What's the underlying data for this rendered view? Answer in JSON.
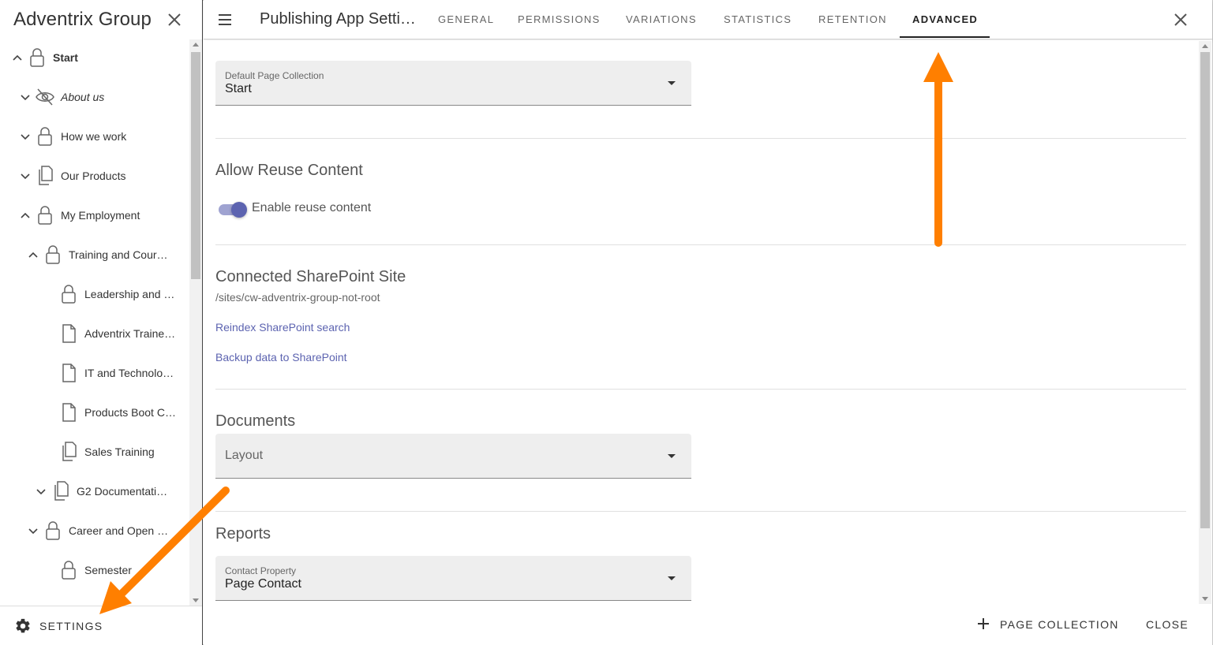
{
  "sidebar": {
    "title": "Adventrix Group",
    "items": [
      {
        "label": "Start",
        "chevron": "up",
        "icon": "lock-icon",
        "style": "bold"
      },
      {
        "label": "About us",
        "chevron": "down",
        "icon": "eye-off-icon",
        "style": "italic"
      },
      {
        "label": "How we work",
        "chevron": "down",
        "icon": "lock-icon",
        "style": ""
      },
      {
        "label": "Our Products",
        "chevron": "down",
        "icon": "pages-icon",
        "style": ""
      },
      {
        "label": "My Employment",
        "chevron": "up",
        "icon": "lock-icon",
        "style": ""
      },
      {
        "label": "Training and Cour…",
        "chevron": "up",
        "icon": "lock-icon",
        "style": ""
      },
      {
        "label": "Leadership and …",
        "chevron": "",
        "icon": "lock-icon",
        "style": ""
      },
      {
        "label": "Adventrix Traine…",
        "chevron": "",
        "icon": "page-icon",
        "style": ""
      },
      {
        "label": "IT and Technolo…",
        "chevron": "",
        "icon": "page-icon",
        "style": ""
      },
      {
        "label": "Products Boot C…",
        "chevron": "",
        "icon": "page-icon",
        "style": ""
      },
      {
        "label": "Sales Training",
        "chevron": "",
        "icon": "pages-icon",
        "style": ""
      },
      {
        "label": "G2 Documentati…",
        "chevron": "down",
        "icon": "pages-icon",
        "style": ""
      },
      {
        "label": "Career and Open …",
        "chevron": "down",
        "icon": "lock-icon",
        "style": ""
      },
      {
        "label": "Semester",
        "chevron": "",
        "icon": "lock-icon",
        "style": ""
      }
    ],
    "settings_label": "SETTINGS"
  },
  "dialog": {
    "title": "Publishing App Setti…",
    "tabs": [
      {
        "label": "GENERAL",
        "active": false
      },
      {
        "label": "PERMISSIONS",
        "active": false
      },
      {
        "label": "VARIATIONS",
        "active": false
      },
      {
        "label": "STATISTICS",
        "active": false
      },
      {
        "label": "RETENTION",
        "active": false
      },
      {
        "label": "ADVANCED",
        "active": true
      }
    ],
    "default_page_collection": {
      "label": "Default Page Collection",
      "value": "Start"
    },
    "reuse": {
      "title": "Allow Reuse Content",
      "toggle_label": "Enable reuse content",
      "enabled": true
    },
    "sharepoint": {
      "title": "Connected SharePoint Site",
      "path": "/sites/cw-adventrix-group-not-root",
      "reindex_link": "Reindex SharePoint search",
      "backup_link": "Backup data to SharePoint"
    },
    "documents": {
      "title": "Documents",
      "layout_placeholder": "Layout"
    },
    "reports": {
      "title": "Reports",
      "contact_label": "Contact Property",
      "contact_value": "Page Contact"
    },
    "footer": {
      "add_collection": "PAGE COLLECTION",
      "close": "CLOSE"
    }
  },
  "colors": {
    "accent": "#5c63b0",
    "annotation_arrow": "#ff7f00",
    "toggle_track": "#9fa3d1"
  }
}
